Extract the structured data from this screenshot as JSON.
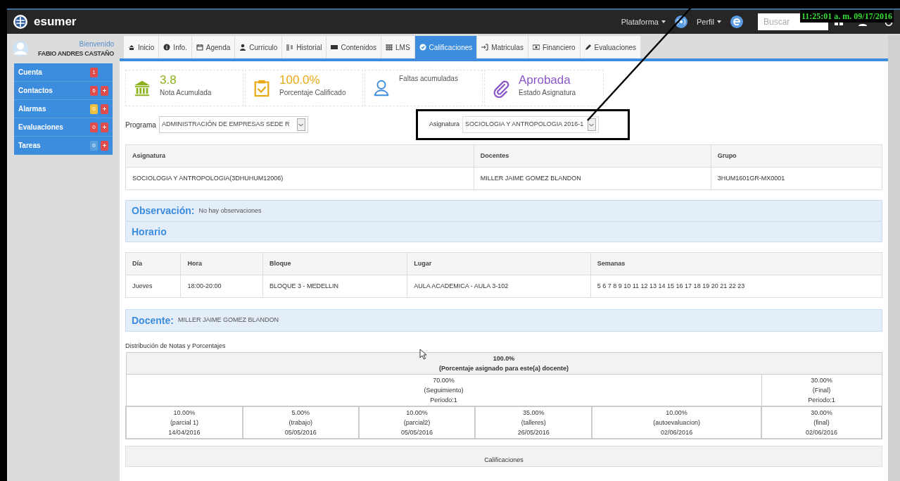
{
  "navbar": {
    "brand": "esumer",
    "menus": [
      "Plataforma",
      "Perfil"
    ],
    "search": {
      "placeholder": "Buscar"
    },
    "clock": "11:25:01 a. m. 09/17/2016"
  },
  "user": {
    "greeting": "Bienvenido",
    "name": "FABIO ANDRES CASTAÑO"
  },
  "sidebar": {
    "items": [
      {
        "label": "Cuenta",
        "badge": "1",
        "color": "#e04b4b",
        "button": false
      },
      {
        "label": "Contactos",
        "badge": "6",
        "color": "#e04b4b",
        "button": true
      },
      {
        "label": "Alarmas",
        "badge": "0",
        "color": "#f0c040",
        "button": true
      },
      {
        "label": "Evaluaciones",
        "badge": "0",
        "color": "#e04b4b",
        "button": true
      },
      {
        "label": "Tareas",
        "badge": "0",
        "color": "#5aa0dc",
        "button": true
      }
    ]
  },
  "tabs": [
    {
      "label": "Inicio",
      "kind": "home",
      "selected": false
    },
    {
      "label": "Info.",
      "kind": "info",
      "selected": false
    },
    {
      "label": "Agenda",
      "kind": "calendar",
      "selected": false
    },
    {
      "label": "Curriculo",
      "kind": "person",
      "selected": false
    },
    {
      "label": "Historial",
      "kind": "bars",
      "selected": false
    },
    {
      "label": "Contenidos",
      "kind": "card",
      "selected": false
    },
    {
      "label": "LMS",
      "kind": "grid",
      "selected": false
    },
    {
      "label": "Calificaciones",
      "kind": "check",
      "selected": true
    },
    {
      "label": "Matriculas",
      "kind": "signin",
      "selected": false
    },
    {
      "label": "Financiero",
      "kind": "money",
      "selected": false
    },
    {
      "label": "Evaluaciones",
      "kind": "pencil",
      "selected": false
    }
  ],
  "stats": [
    {
      "kind": "bank",
      "value": "3.8",
      "label": "Nota Acumulada",
      "color": "#8cb31e"
    },
    {
      "kind": "clipboard",
      "value": "100.0%",
      "label": "Porcentaje Calificado",
      "color": "#e8aa14"
    },
    {
      "kind": "user",
      "label": "Faltas acumuladas",
      "color": "#3c8dde"
    },
    {
      "kind": "clip",
      "value": "Aprobada",
      "label": "Estado Asignatura",
      "color": "#8a56c8"
    }
  ],
  "programa": {
    "label": "Programa",
    "value": "ADMINISTRACIÓN DE EMPRESAS SEDE R"
  },
  "asignatura": {
    "label": "Asignatura",
    "value": "SOCIOLOGIA Y ANTROPOLOGIA 2016-1"
  },
  "course_table": {
    "columns": [
      "Asignatura",
      "Docentes",
      "Grupo"
    ],
    "rows": [
      [
        "SOCIOLOGIA Y ANTROPOLOGIA(3DHUHUM12006)",
        "MILLER JAIME GOMEZ BLANDON",
        "3HUM1601GR-MX0001"
      ]
    ]
  },
  "observacion": {
    "title": "Observación:",
    "text": "No hay observaciones"
  },
  "horario": {
    "title": "Horario",
    "columns": [
      "Día",
      "Hora",
      "Bloque",
      "Lugar",
      "Semanas"
    ],
    "rows": [
      [
        "Jueves",
        "18:00-20:00",
        "BLOQUE 3 - MEDELLIN",
        "AULA ACADEMICA - AULA 3-102",
        "5 6 7 8 9 10 11 12 13 14 15 16 17 18 19 20 21 22 23"
      ]
    ]
  },
  "docente": {
    "title": "Docente:",
    "text": "MILLER JAIME GOMEZ BLANDON"
  },
  "distribution": {
    "title": "Distribución de Notas y Porcentajes",
    "total": {
      "percent": "100.0%",
      "label": "(Porcentaje asignado para este(a) docente)"
    },
    "groups": [
      {
        "percent": "70.00%",
        "label": "(Seguimiento)",
        "period": "Periodo:1",
        "items": [
          {
            "percent": "10.00%",
            "label": "(parcial 1)",
            "date": "14/04/2016"
          },
          {
            "percent": "5.00%",
            "label": "(trabajo)",
            "date": "05/05/2016"
          },
          {
            "percent": "10.00%",
            "label": "(parcial2)",
            "date": "05/05/2016"
          },
          {
            "percent": "35.00%",
            "label": "(talleres)",
            "date": "26/05/2016"
          },
          {
            "percent": "10.00%",
            "label": "(autoevaluacion)",
            "date": "02/06/2016"
          }
        ]
      },
      {
        "percent": "30.00%",
        "label": "(Final)",
        "period": "Periodo:1",
        "items": [
          {
            "percent": "30.00%",
            "label": "(final)",
            "date": "02/06/2016"
          }
        ]
      }
    ]
  },
  "calificaciones": {
    "title": "Calificaciones"
  }
}
